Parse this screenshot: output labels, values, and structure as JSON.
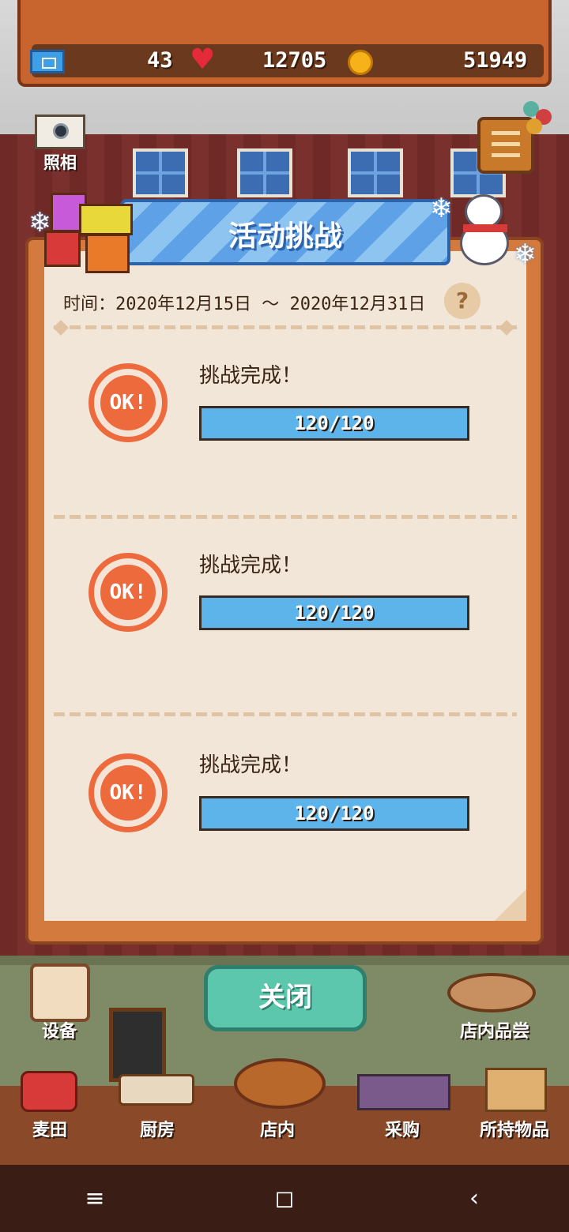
{
  "hud": {
    "tickets": "43",
    "hearts": "12705",
    "coins": "51949"
  },
  "side_buttons": {
    "camera_label": "照相"
  },
  "dialog": {
    "title": "活动挑战",
    "period": "时间：2020年12月15日 ～ 2020年12月31日",
    "help_label": "?",
    "challenges": [
      {
        "stamp": "OK!",
        "status": "挑战完成！",
        "progress_text": "120/120",
        "progress": 1.0
      },
      {
        "stamp": "OK!",
        "status": "挑战完成！",
        "progress_text": "120/120",
        "progress": 1.0
      },
      {
        "stamp": "OK!",
        "status": "挑战完成！",
        "progress_text": "120/120",
        "progress": 1.0
      }
    ],
    "close_label": "关闭"
  },
  "scene_buttons": {
    "equipment": "设备",
    "tasting": "店内品尝"
  },
  "bottom_tabs": [
    {
      "label": "麦田",
      "icon": "wheat-field-icon"
    },
    {
      "label": "厨房",
      "icon": "kitchen-icon"
    },
    {
      "label": "店内",
      "icon": "bread-basket-icon"
    },
    {
      "label": "采购",
      "icon": "shelf-icon"
    },
    {
      "label": "所持物品",
      "icon": "box-icon"
    }
  ],
  "system_nav": {
    "menu": "≡",
    "home": "◻",
    "back": "‹"
  },
  "colors": {
    "progress": "#5db4ea",
    "stamp": "#ec6a3c",
    "close_button": "#5cc7ad",
    "banner": "#5ea1e6"
  }
}
